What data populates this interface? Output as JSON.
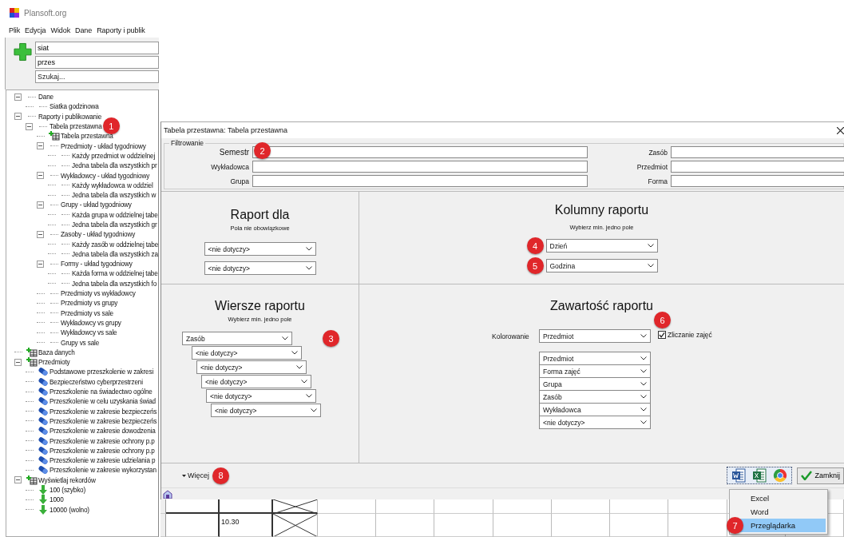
{
  "app": {
    "title": "Plansoft.org"
  },
  "menu": [
    {
      "label": "Plik"
    },
    {
      "label": "Edycja"
    },
    {
      "label": "Widok"
    },
    {
      "label": "Dane"
    },
    {
      "label": "Raporty i publik"
    }
  ],
  "search_fields": [
    {
      "value": "siat"
    },
    {
      "value": "przes"
    },
    {
      "placeholder": "Szukaj..."
    }
  ],
  "tree": [
    {
      "label": "Dane",
      "kind": "plain",
      "expanded": true,
      "children": [
        {
          "label": "Siatka godzinowa",
          "kind": "plain"
        }
      ]
    },
    {
      "label": "Raporty i publikowanie",
      "kind": "plain",
      "expanded": true,
      "children": [
        {
          "label": "Tabela przestawna",
          "kind": "plain",
          "expanded": true,
          "badge": "1",
          "children": [
            {
              "label": "Tabela przestawna",
              "kind": "table"
            },
            {
              "label": "Przedmioty - układ tygodniowy",
              "kind": "plain",
              "expanded": true,
              "children": [
                {
                  "label": "Każdy przedmiot w oddzielnej",
                  "kind": "plain"
                },
                {
                  "label": "Jedna tabela dla wszystkich pr",
                  "kind": "plain"
                }
              ]
            },
            {
              "label": "Wykładowcy - układ tygodniowy",
              "kind": "plain",
              "expanded": true,
              "children": [
                {
                  "label": "Każdy wykładowca w oddziel",
                  "kind": "plain"
                },
                {
                  "label": "Jedna tabela dla wszystkich w",
                  "kind": "plain"
                }
              ]
            },
            {
              "label": "Grupy - układ tygodniowy",
              "kind": "plain",
              "expanded": true,
              "children": [
                {
                  "label": "Każda grupa w oddzielnej tabe",
                  "kind": "plain"
                },
                {
                  "label": "Jedna tabela dla wszystkich gr",
                  "kind": "plain"
                }
              ]
            },
            {
              "label": "Zasoby - układ tygodniowy",
              "kind": "plain",
              "expanded": true,
              "children": [
                {
                  "label": "Każdy zasób w oddzielnej tabe",
                  "kind": "plain"
                },
                {
                  "label": "Jedna tabela dla wszystkich za",
                  "kind": "plain"
                }
              ]
            },
            {
              "label": "Formy - układ tygodniowy",
              "kind": "plain",
              "expanded": true,
              "children": [
                {
                  "label": "Każda forma w oddzielnej tabe",
                  "kind": "plain"
                },
                {
                  "label": "Jedna tabela dla wszystkich fo",
                  "kind": "plain"
                }
              ]
            },
            {
              "label": "Przedmioty vs wykładowcy",
              "kind": "plain"
            },
            {
              "label": "Przedmioty vs grupy",
              "kind": "plain"
            },
            {
              "label": "Przedmioty vs sale",
              "kind": "plain"
            },
            {
              "label": "Wykładowcy vs grupy",
              "kind": "plain"
            },
            {
              "label": "Wykładowcy vs sale",
              "kind": "plain"
            },
            {
              "label": "Grupy vs sale",
              "kind": "plain"
            }
          ]
        }
      ]
    },
    {
      "label": "Baza danych",
      "kind": "table"
    },
    {
      "label": "Przedmioty",
      "kind": "table",
      "expanded": true,
      "children": [
        {
          "label": "Podstawowe przeszkolenie w zakresi",
          "kind": "capsule"
        },
        {
          "label": "Bezpieczeństwo cyberprzestrzeni",
          "kind": "capsule"
        },
        {
          "label": "Przeszkolenie na świadectwo ogólne",
          "kind": "capsule"
        },
        {
          "label": "Przeszkolenie w celu uzyskania świad",
          "kind": "capsule"
        },
        {
          "label": "Przeszkolenie w zakresie bezpieczeńs",
          "kind": "capsule"
        },
        {
          "label": "Przeszkolenie w zakresie bezpieczeńs",
          "kind": "capsule"
        },
        {
          "label": "Przeszkolenie w zakresie dowodzenia",
          "kind": "capsule"
        },
        {
          "label": "Przeszkolenie w zakresie ochrony p.p",
          "kind": "capsule"
        },
        {
          "label": "Przeszkolenie w zakresie ochrony p.p",
          "kind": "capsule"
        },
        {
          "label": "Przeszkolenie w zakresie udzielania p",
          "kind": "capsule"
        },
        {
          "label": "Przeszkolenie w zakresie wykorzystan",
          "kind": "capsule"
        }
      ]
    },
    {
      "label": "Wyświetlaj rekordów",
      "kind": "table",
      "expanded": true,
      "children": [
        {
          "label": "100 (szybko)",
          "kind": "arrow"
        },
        {
          "label": "1000",
          "kind": "arrow"
        },
        {
          "label": "10000 (wolno)",
          "kind": "arrow"
        }
      ]
    }
  ],
  "dialog": {
    "title": "Tabela przestawna: Tabela przestawna",
    "filter": {
      "title": "Filtrowanie",
      "fields": [
        {
          "label": "Semestr",
          "badge": "2"
        },
        {
          "label": "Zasób"
        },
        {
          "label": "Wykładowca"
        },
        {
          "label": "Przedmiot"
        },
        {
          "label": "Grupa"
        },
        {
          "label": "Forma"
        }
      ]
    },
    "sections": [
      {
        "kind": "plain",
        "title": "Raport dla",
        "subtitle": "Pola nie obowiązkowe",
        "selects": [
          {
            "value": "<nie dotyczy>"
          },
          {
            "value": "<nie dotyczy>"
          }
        ]
      },
      {
        "kind": "plain",
        "title": "Kolumny raportu",
        "subtitle": "Wybierz min. jedno pole",
        "selects": [
          {
            "value": "Dzień",
            "badge": "4"
          },
          {
            "value": "Godzina",
            "badge": "5"
          }
        ]
      },
      {
        "kind": "staircase",
        "title": "Wiersze raportu",
        "subtitle": "Wybierz min. jedno pole",
        "selects": [
          {
            "value": "Zasób",
            "badge": "3"
          },
          {
            "value": "<nie dotyczy>"
          },
          {
            "value": "<nie dotyczy>"
          },
          {
            "value": "<nie dotyczy>"
          },
          {
            "value": "<nie dotyczy>"
          },
          {
            "value": "<nie dotyczy>"
          }
        ]
      },
      {
        "kind": "content",
        "title": "Zawartość raportu",
        "coloring": {
          "label": "Kolorowanie",
          "value": "Przedmiot"
        },
        "checkbox": {
          "label": "Zliczanie zajęć",
          "checked": true,
          "badge": "6"
        },
        "selects": [
          {
            "value": "Przedmiot"
          },
          {
            "value": "Forma zajęć"
          },
          {
            "value": "Grupa"
          },
          {
            "value": "Zasób"
          },
          {
            "value": "Wykładowca"
          },
          {
            "value": "<nie dotyczy>"
          }
        ]
      }
    ],
    "more": {
      "label": "Więcej",
      "badge": "8"
    },
    "export_buttons": [
      {
        "kind": "word"
      },
      {
        "kind": "excel"
      },
      {
        "kind": "browser"
      }
    ],
    "close_button": {
      "label": "Zamknij"
    }
  },
  "export_menu": [
    {
      "label": "Excel",
      "selected": false
    },
    {
      "label": "Word",
      "selected": false
    },
    {
      "label": "Przeglądarka",
      "selected": true,
      "badge": "7"
    }
  ],
  "schedule": {
    "times": [
      "10.30"
    ]
  }
}
